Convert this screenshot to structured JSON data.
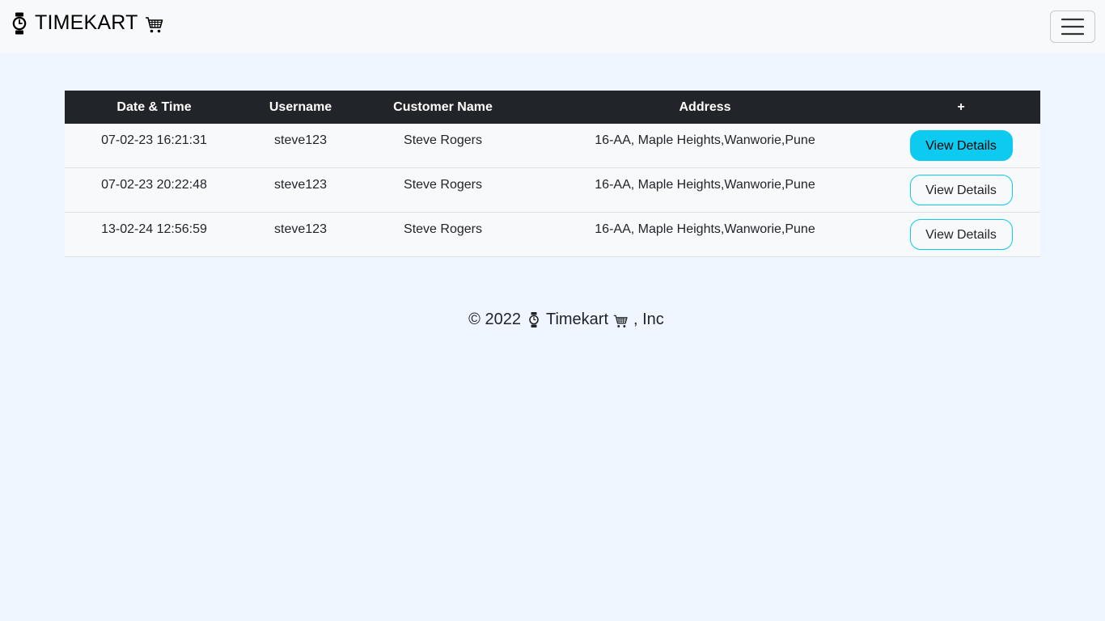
{
  "navbar": {
    "brand_text": "TIMEKART",
    "brand_watch_icon": "watch-icon",
    "brand_cart_icon": "cart-icon",
    "toggler_icon": "hamburger-menu-icon"
  },
  "orders_table": {
    "headers": [
      "Date & Time",
      "Username",
      "Customer Name",
      "Address",
      "+"
    ],
    "rows": [
      {
        "datetime": "07-02-23 16:21:31",
        "username": "steve123",
        "customer_name": "Steve Rogers",
        "address": "16-AA, Maple Heights,Wanworie,Pune",
        "button_label": "View Details"
      },
      {
        "datetime": "07-02-23 20:22:48",
        "username": "steve123",
        "customer_name": "Steve Rogers",
        "address": "16-AA, Maple Heights,Wanworie,Pune",
        "button_label": "View Details"
      },
      {
        "datetime": "13-02-24 12:56:59",
        "username": "steve123",
        "customer_name": "Steve Rogers",
        "address": "16-AA, Maple Heights,Wanworie,Pune",
        "button_label": "View Details"
      }
    ]
  },
  "footer": {
    "copyright": "© 2022",
    "brand": "Timekart",
    "suffix": ", Inc"
  },
  "colors": {
    "accent": "#0dcaf0",
    "header_bg": "#212529",
    "page_bg": "#eff6ff",
    "navbar_bg": "#f8f9fa"
  }
}
